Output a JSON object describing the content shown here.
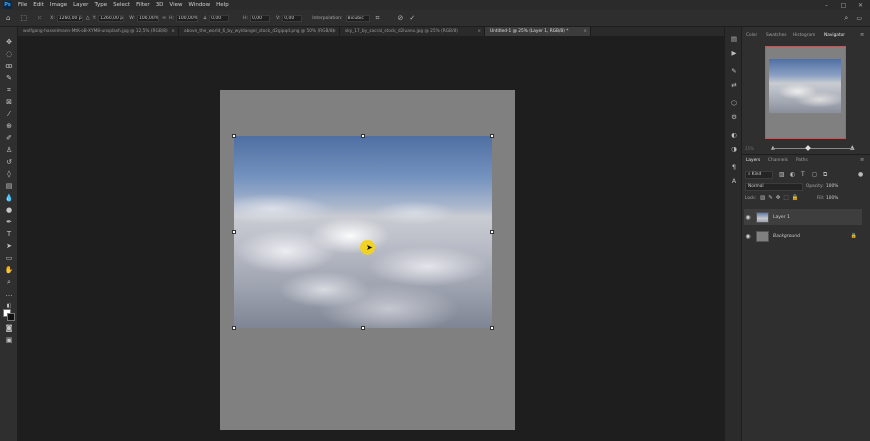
{
  "app": {
    "logo": "Ps"
  },
  "menu": [
    "File",
    "Edit",
    "Image",
    "Layer",
    "Type",
    "Select",
    "Filter",
    "3D",
    "View",
    "Window",
    "Help"
  ],
  "options": {
    "x_label": "X:",
    "x_value": "1260,00 px",
    "y_label": "Y:",
    "y_value": "1260,00 px",
    "w_label": "W:",
    "w_value": "100,00%",
    "h_label": "H:",
    "h_value": "100,00%",
    "angle_label": "∡",
    "angle_value": "0,00",
    "hskew_label": "H:",
    "hskew_value": "0,00",
    "vskew_label": "V:",
    "vskew_value": "0,00",
    "interp_label": "Interpolation:",
    "interp_value": "Bicubic"
  },
  "tabs": [
    {
      "label": "wolfgang-hasselmann-MtK-oB-XYM8-unsplash.jpg @ 12,5% (RGB/8)"
    },
    {
      "label": "above_the_world_6_by_wyldangel_stock_d2gipqd.png @ 50% (RGB/8)"
    },
    {
      "label": "sky_17_by_sacral_stock_d2luanx.jpg @ 25% (RGB/8)"
    },
    {
      "label": "Untitled-1 @ 25% (Layer 1, RGB/8) *",
      "active": true
    }
  ],
  "panels": {
    "top_tabs": [
      "Color",
      "Swatches",
      "Histogram",
      "Navigator"
    ],
    "nav_zoom": "25%",
    "layer_tabs": [
      "Layers",
      "Channels",
      "Paths"
    ],
    "kind_label": "Kind",
    "blend_mode": "Normal",
    "opacity_label": "Opacity:",
    "opacity_value": "100%",
    "lock_label": "Lock:",
    "fill_label": "Fill:",
    "fill_value": "100%",
    "layers": [
      {
        "name": "Layer 1",
        "selected": true
      },
      {
        "name": "Background",
        "locked": true
      }
    ]
  }
}
